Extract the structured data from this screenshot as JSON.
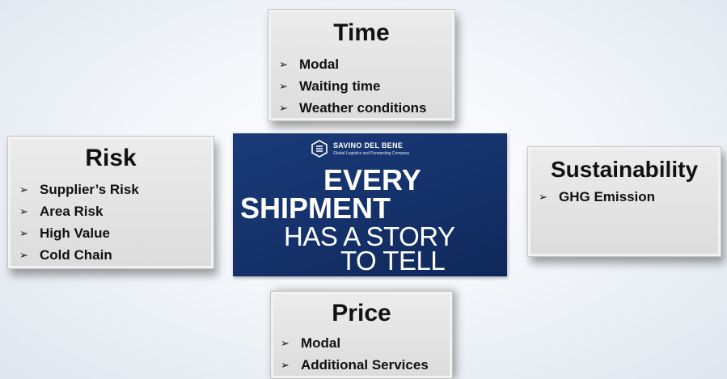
{
  "time": {
    "title": "Time",
    "items": [
      "Modal",
      "Waiting time",
      "Weather conditions"
    ]
  },
  "risk": {
    "title": "Risk",
    "items": [
      "Supplier’s Risk",
      "Area Risk",
      "High Value",
      "Cold Chain"
    ]
  },
  "sustainability": {
    "title": "Sustainability",
    "items": [
      "GHG Emission"
    ]
  },
  "price": {
    "title": "Price",
    "items": [
      "Modal",
      "Additional Services"
    ]
  },
  "center": {
    "company_name": "SAVINO DEL BENE",
    "company_tagline": "Global Logistics and Forwarding Company",
    "line1": "EVERY",
    "line2": "SHIPMENT",
    "line3": "HAS A STORY",
    "line4": "TO TELL",
    "background_color": "#14316a"
  },
  "bullet_glyph": "➢"
}
